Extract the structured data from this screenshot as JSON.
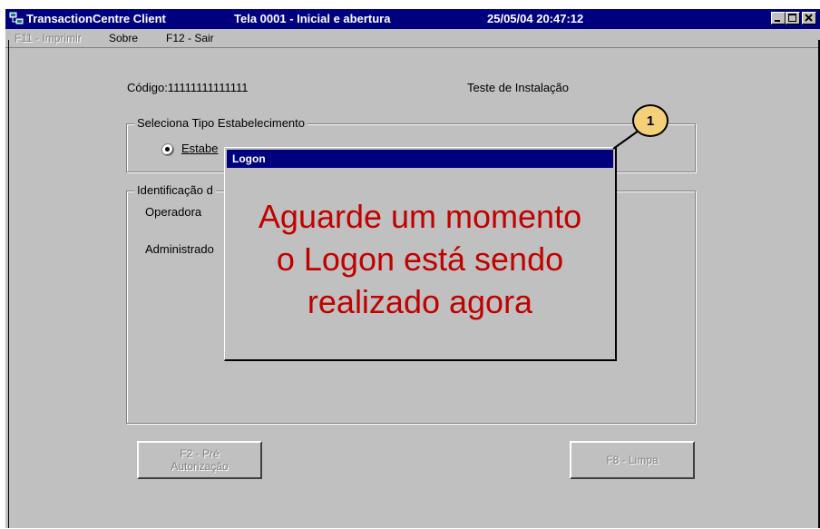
{
  "window": {
    "app_title": "TransactionCentre Client",
    "screen_title": "Tela 0001 - Inicial e abertura",
    "datetime": "25/05/04 20:47:12",
    "app_icon": "network-computer-icon",
    "controls": [
      "minimize-icon",
      "maximize-icon",
      "close-icon"
    ]
  },
  "menu": {
    "print": "F11 - Imprimir",
    "about": "Sobre",
    "exit": "F12 - Sair"
  },
  "form": {
    "codigo": "Código:11111111111111",
    "teste": "Teste de Instalação",
    "tipo_group_title": "Seleciona Tipo Estabelecimento",
    "radio_estabelecimento_partial": "Estabe",
    "ident_group_title_partial": "Identificação d",
    "operadora_label": "Operadora",
    "administradora_partial": "Administrado"
  },
  "buttons": {
    "pre_autorizacao": "F2 - Pré Autorização",
    "pre_autorizacao_line1": "F2 - Pré",
    "pre_autorizacao_line2": "Autorização",
    "limpa": "F8 - Limpa"
  },
  "dialog": {
    "title": "Logon",
    "line1": "Aguarde um momento",
    "line2": "o Logon está sendo",
    "line3": "realizado agora"
  },
  "callout": {
    "number": "1",
    "color": "#f4d07a"
  },
  "colors": {
    "titlebar": "#00007e",
    "dialog_text": "#c00000",
    "face": "#c0c0c0"
  }
}
